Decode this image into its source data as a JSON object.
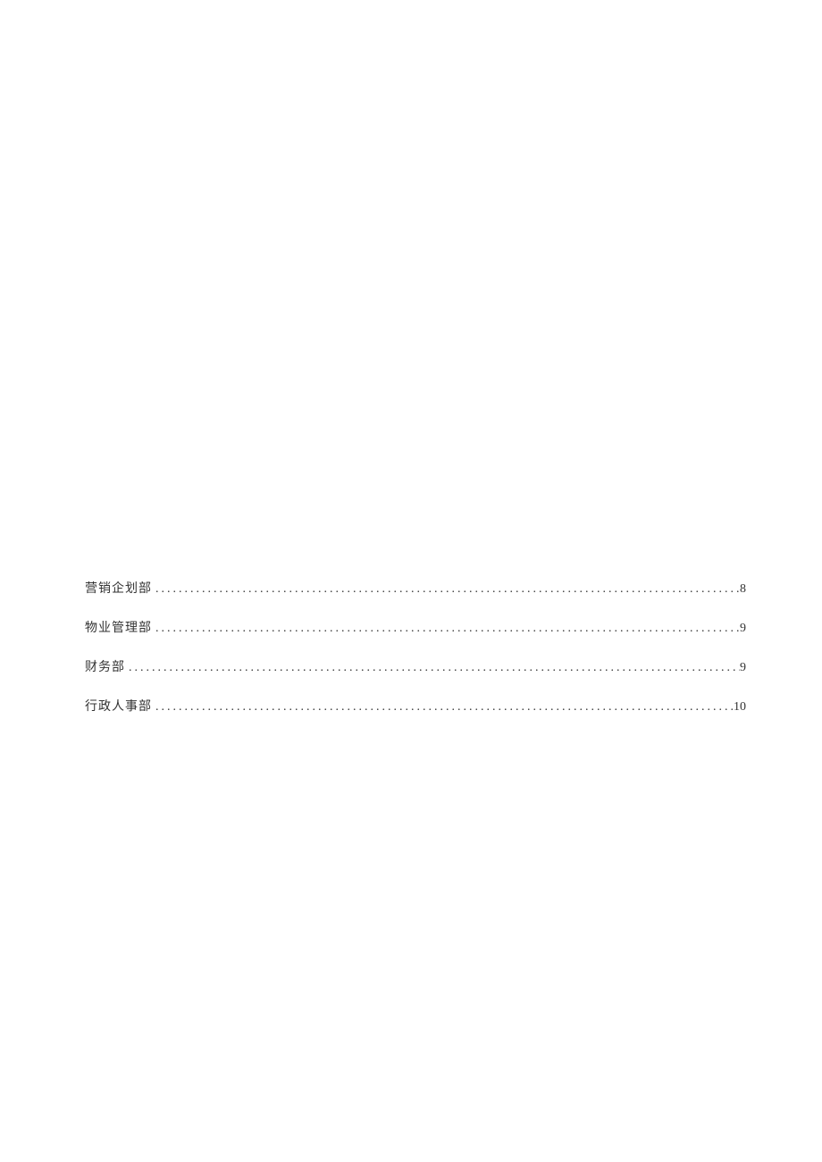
{
  "toc": {
    "entries": [
      {
        "title": "营销企划部",
        "page": "8"
      },
      {
        "title": "物业管理部",
        "page": "9"
      },
      {
        "title": "财务部",
        "page": "9"
      },
      {
        "title": "行政人事部",
        "page": "10"
      }
    ]
  }
}
